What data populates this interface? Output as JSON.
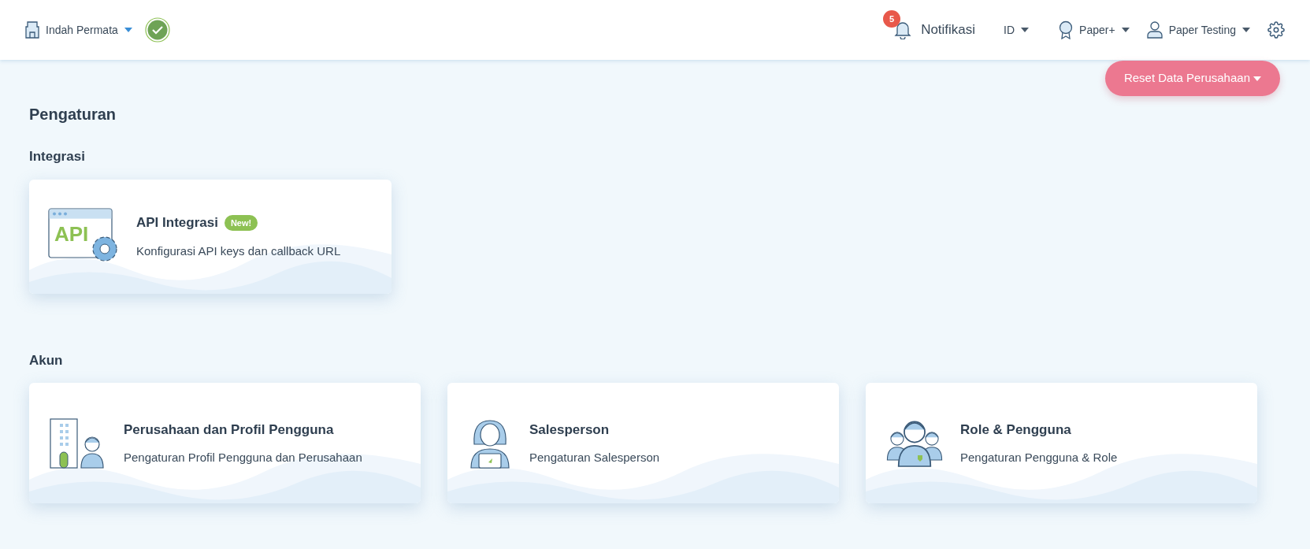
{
  "header": {
    "company": "Indah Permata",
    "verified": true,
    "notification_count": "5",
    "notification_label": "Notifikasi",
    "language": "ID",
    "plan": "Paper+",
    "user": "Paper Testing"
  },
  "reset_button": "Reset Data Perusahaan",
  "page_title": "Pengaturan",
  "sections": [
    {
      "title": "Integrasi",
      "cards": [
        {
          "kind": "api",
          "title": "API Integrasi",
          "badge": "New!",
          "description": "Konfigurasi API keys dan callback URL",
          "art_text": "API"
        }
      ]
    },
    {
      "title": "Akun",
      "cards": [
        {
          "kind": "company",
          "title": "Perusahaan dan Profil Pengguna",
          "description": "Pengaturan Profil Pengguna dan Perusahaan"
        },
        {
          "kind": "salesperson",
          "title": "Salesperson",
          "description": "Pengaturan Salesperson"
        },
        {
          "kind": "roles",
          "title": "Role & Pengguna",
          "description": "Pengaturan Pengguna & Role"
        }
      ]
    }
  ]
}
